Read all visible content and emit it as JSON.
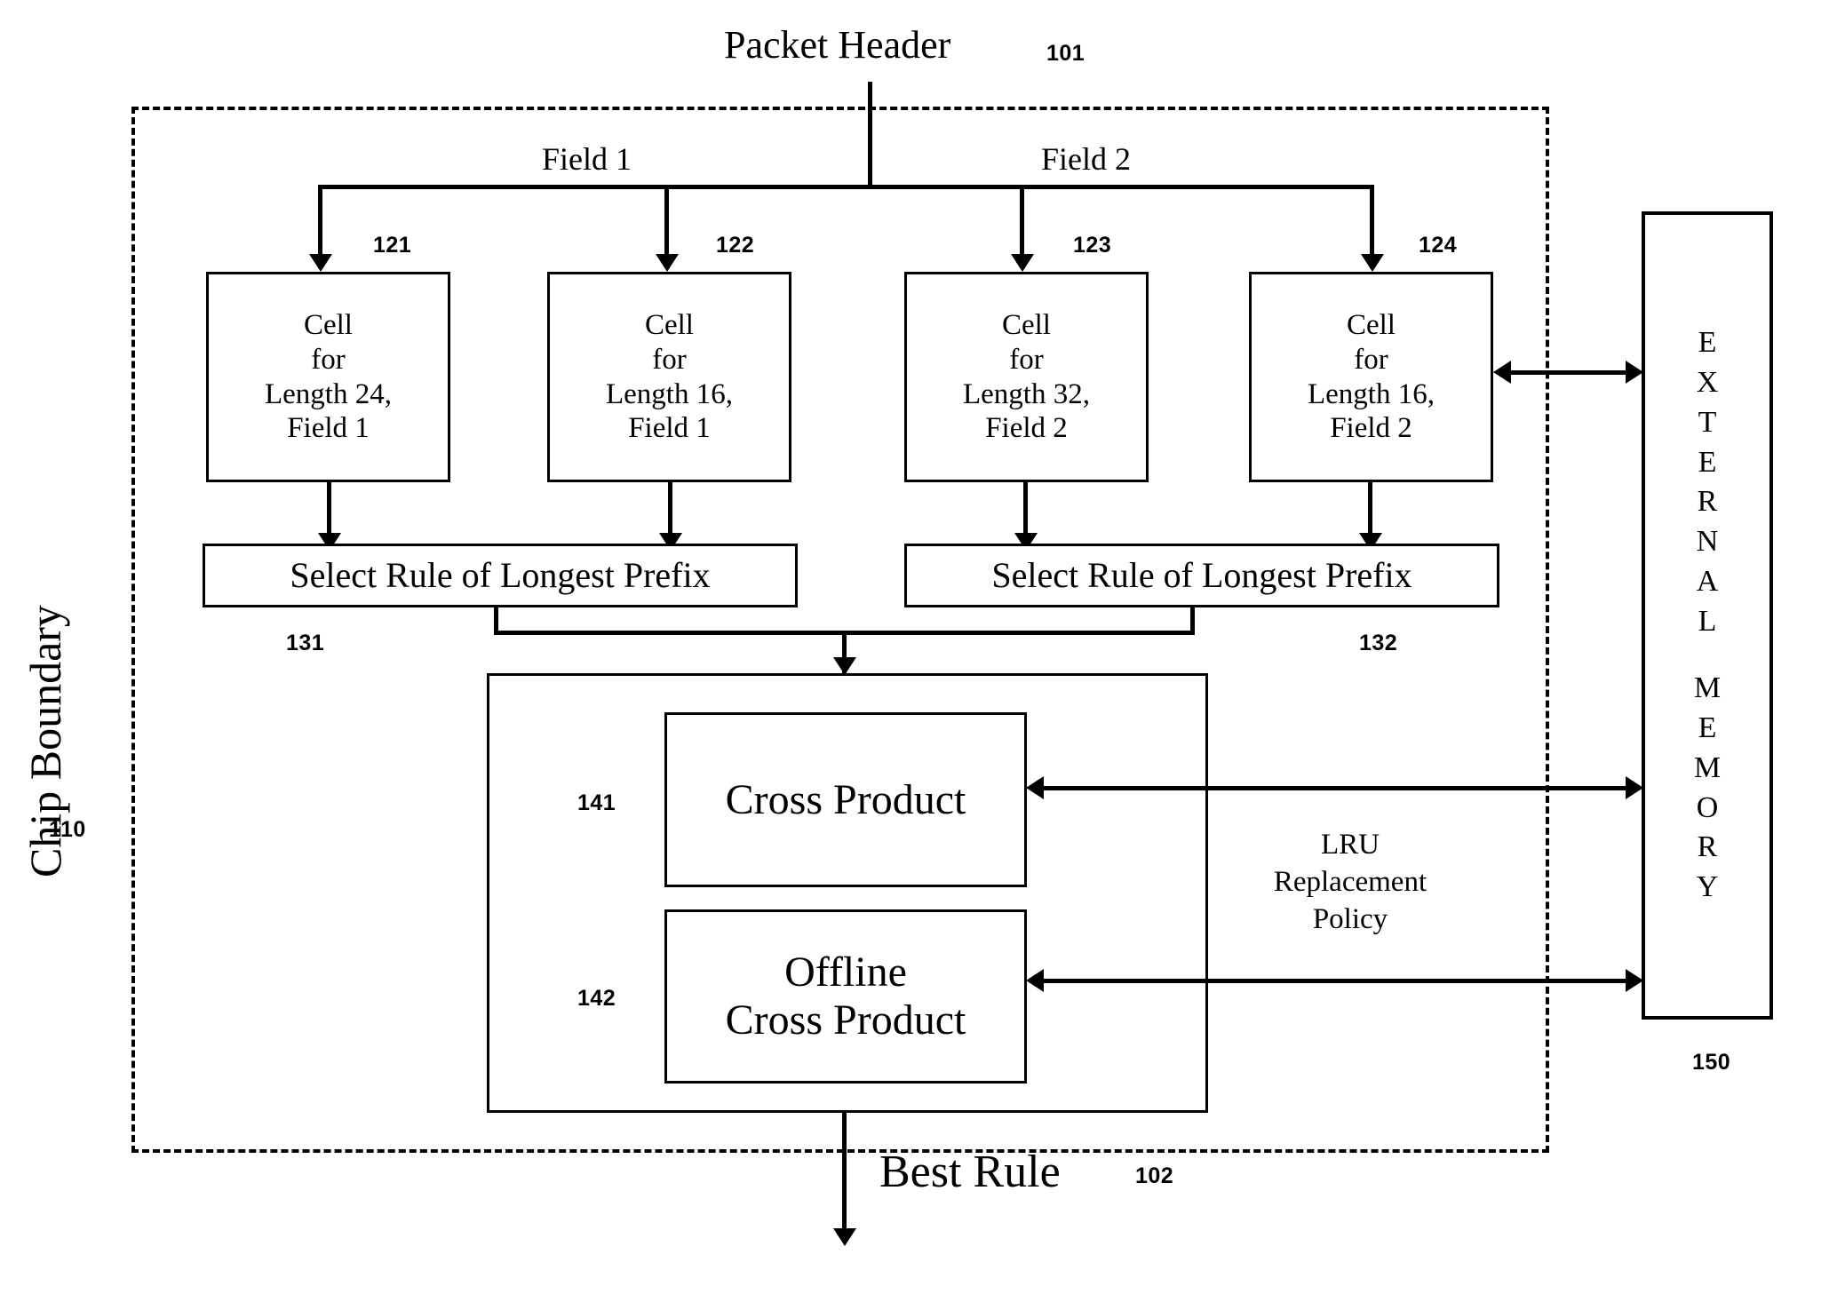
{
  "figure": {
    "input_label": "Packet Header",
    "input_ref": "101",
    "output_label": "Best Rule",
    "output_ref": "102",
    "chip_label": "Chip Boundary",
    "chip_ref": "110"
  },
  "fields": {
    "field1_label": "Field 1",
    "field2_label": "Field 2"
  },
  "cells": [
    {
      "ref": "121",
      "line1": "Cell",
      "line2": "for",
      "line3": "Length 24,",
      "line4": "Field 1"
    },
    {
      "ref": "122",
      "line1": "Cell",
      "line2": "for",
      "line3": "Length 16,",
      "line4": "Field 1"
    },
    {
      "ref": "123",
      "line1": "Cell",
      "line2": "for",
      "line3": "Length 32,",
      "line4": "Field 2"
    },
    {
      "ref": "124",
      "line1": "Cell",
      "line2": "for",
      "line3": "Length 16,",
      "line4": "Field 2"
    }
  ],
  "selectors": [
    {
      "ref": "131",
      "label": "Select Rule of Longest Prefix"
    },
    {
      "ref": "132",
      "label": "Select Rule of Longest Prefix"
    }
  ],
  "cross_product": {
    "primary": {
      "ref": "141",
      "label": "Cross Product"
    },
    "offline": {
      "ref": "142",
      "line1": "Offline",
      "line2": "Cross Product"
    }
  },
  "policy": {
    "line1": "LRU",
    "line2": "Replacement",
    "line3": "Policy"
  },
  "external_memory": {
    "ref": "150",
    "letters": "E\nX\nT\nE\nR\nN\nA\nL\n\nM\nE\nM\nO\nR\nY",
    "name": "EXTERNAL MEMORY"
  },
  "colors": {
    "ink": "#000000",
    "paper": "#ffffff"
  }
}
